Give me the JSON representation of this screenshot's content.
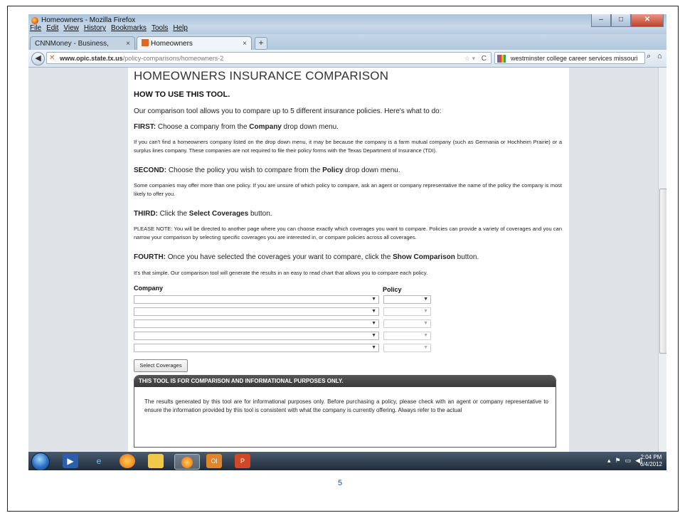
{
  "window": {
    "title": "Homeowners - Mozilla Firefox"
  },
  "menu": [
    "File",
    "Edit",
    "View",
    "History",
    "Bookmarks",
    "Tools",
    "Help"
  ],
  "tabs": [
    {
      "label": "CNNMoney - Business, financial and ...",
      "close": "×"
    },
    {
      "label": "Homeowners",
      "close": "×"
    }
  ],
  "newtab": "+",
  "address": {
    "url_host": "www.opic.state.tx.us",
    "url_path": "/policy-comparisons/homeowners-2"
  },
  "search": {
    "value": "westminster college career services missouri"
  },
  "page": {
    "title": "HOMEOWNERS INSURANCE COMPARISON",
    "subtitle": "HOW TO USE THIS TOOL.",
    "intro": "Our comparison tool allows you to compare up to 5 different insurance policies. Here's what to do:",
    "first_label": "FIRST:",
    "first_text_a": " Choose a company from the ",
    "first_bold": "Company",
    "first_text_b": " drop down menu.",
    "first_note": "If you can't find a homeowners company listed on the drop down menu, it may be because the company is a farm mutual company (such as Germania or Hochheim Prairie) or a surplus lines company. These companies are not required to file their policy forms with the Texas Department of Insurance (TDI).",
    "second_label": "SECOND:",
    "second_text_a": " Choose the policy you wish to compare from the ",
    "second_bold": "Policy",
    "second_text_b": " drop down menu.",
    "second_note": "Some companies may offer more than one policy. If you are unsure of which policy to compare, ask an agent or company representative the name of the policy the company is most likely to offer you.",
    "third_label": "THIRD:",
    "third_text_a": " Click the ",
    "third_bold": "Select Coverages",
    "third_text_b": " button.",
    "third_note": "PLEASE NOTE: You will be directed to another page where you can choose exactly which coverages you want to compare. Policies can provide a variety of coverages and you can narrow your comparison by selecting specific coverages you are interested in, or compare policies across all coverages.",
    "fourth_label": "FOURTH:",
    "fourth_text_a": "  Once you have selected the coverages your want to compare, click the ",
    "fourth_bold": "Show Comparison",
    "fourth_text_b": " button.",
    "fourth_note": "It's that simple. Our comparison tool will generate the results in an easy to read chart that allows you to compare each policy.",
    "company_label": "Company",
    "policy_label": "Policy",
    "select_button": "Select Coverages",
    "notice_header": "THIS TOOL IS FOR COMPARISON AND INFORMATIONAL PURPOSES ONLY.",
    "notice_text": "The results generated by this tool are for informational purposes only. Before purchasing a policy, please check with an agent or company representative to ensure the information provided by this tool is consistent with what the company is currently offering. Always refer to the actual"
  },
  "taskbar": {
    "time": "2:04 PM",
    "date": "6/4/2012"
  },
  "slide_number": "5"
}
